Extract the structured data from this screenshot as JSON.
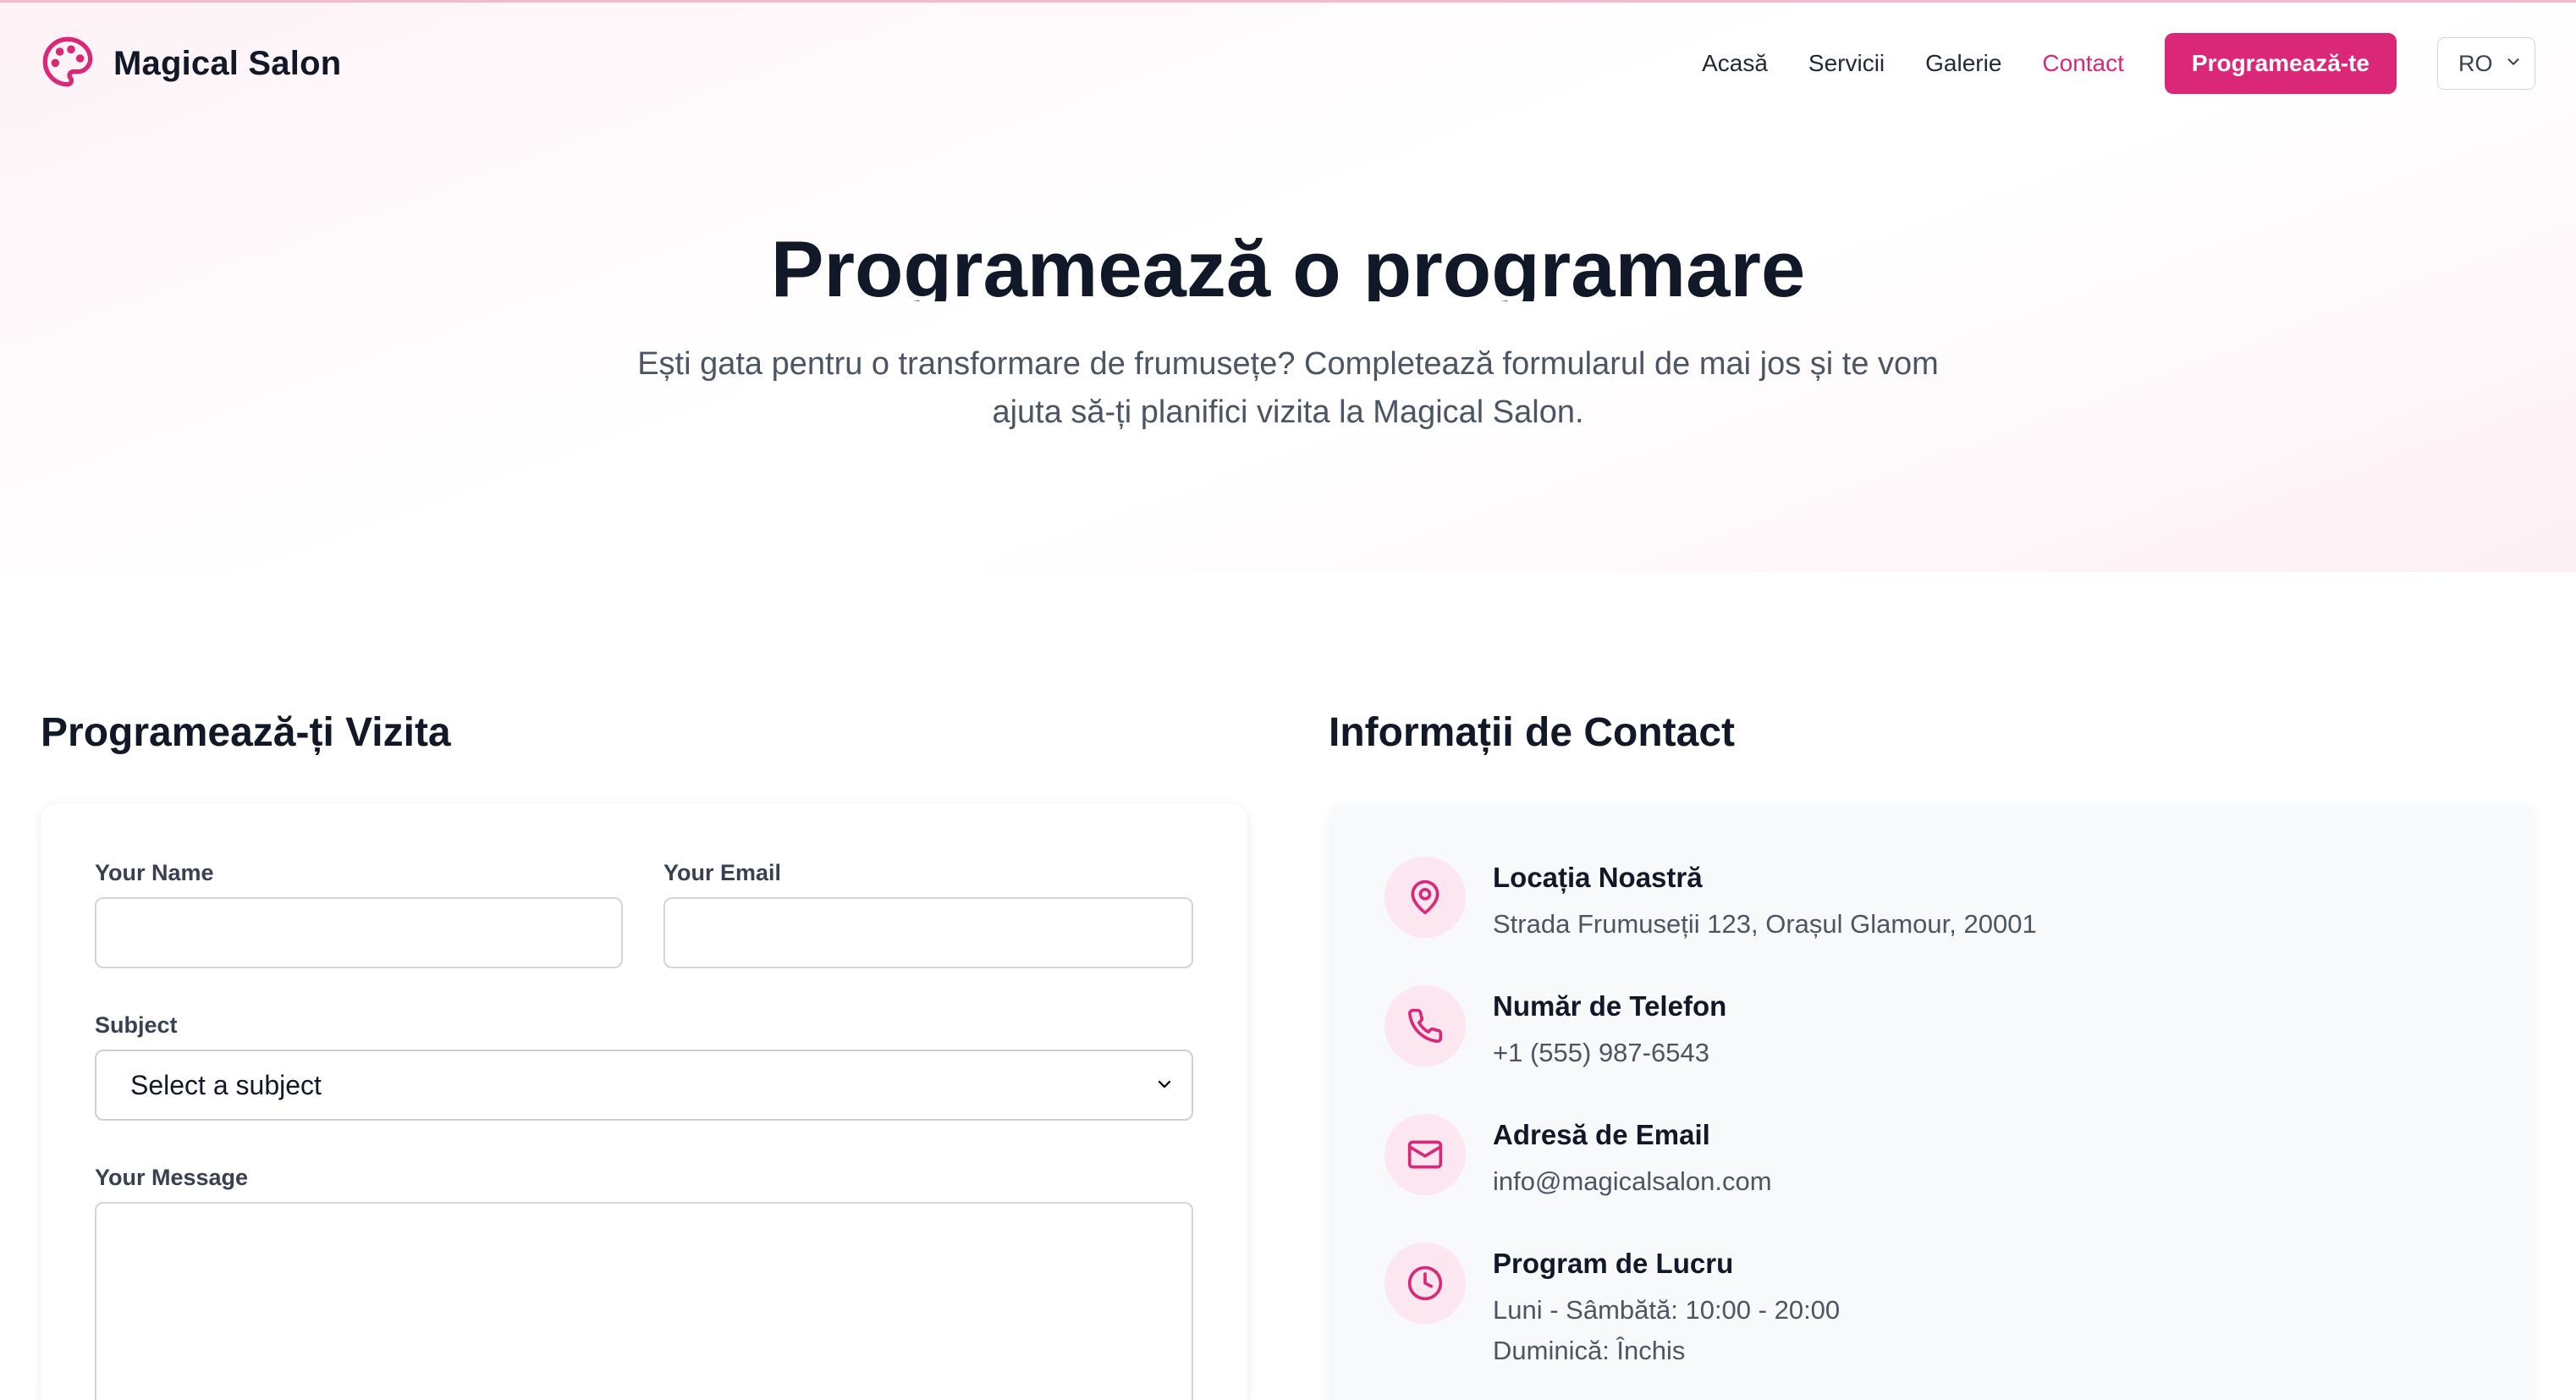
{
  "brand": {
    "name": "Magical Salon",
    "icon": "palette-icon",
    "accent_color": "#db2777"
  },
  "nav": {
    "links": [
      {
        "label": "Acasă",
        "active": false
      },
      {
        "label": "Servicii",
        "active": false
      },
      {
        "label": "Galerie",
        "active": false
      },
      {
        "label": "Contact",
        "active": true
      }
    ],
    "cta_label": "Programează-te",
    "language": "RO"
  },
  "hero": {
    "title": "Programează o programare",
    "subtitle": "Ești gata pentru o transformare de frumusețe? Completează formularul de mai jos și te vom ajuta să-ți planifici vizita la Magical Salon."
  },
  "form": {
    "heading": "Programează-ți Vizita",
    "name_label": "Your Name",
    "name_value": "",
    "email_label": "Your Email",
    "email_value": "",
    "subject_label": "Subject",
    "subject_selected": "Select a subject",
    "message_label": "Your Message",
    "message_value": ""
  },
  "contact": {
    "heading": "Informații de Contact",
    "items": [
      {
        "icon": "map-pin-icon",
        "title": "Locația Noastră",
        "lines": [
          "Strada Frumuseții 123, Orașul Glamour, 20001"
        ]
      },
      {
        "icon": "phone-icon",
        "title": "Număr de Telefon",
        "lines": [
          "+1 (555) 987-6543"
        ]
      },
      {
        "icon": "mail-icon",
        "title": "Adresă de Email",
        "lines": [
          "info@magicalsalon.com"
        ]
      },
      {
        "icon": "clock-icon",
        "title": "Program de Lucru",
        "lines": [
          "Luni - Sâmbătă: 10:00 - 20:00",
          "Duminică: Închis"
        ]
      }
    ]
  }
}
